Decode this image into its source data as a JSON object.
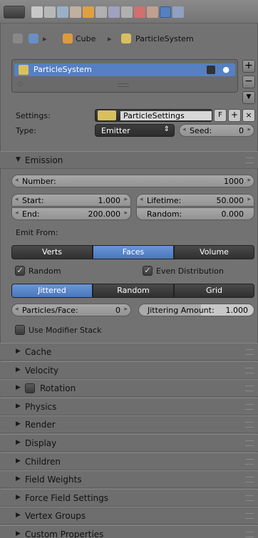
{
  "breadcrumb": {
    "object": "Cube",
    "system": "ParticleSystem"
  },
  "list": {
    "items": [
      {
        "label": "ParticleSystem"
      }
    ]
  },
  "settings": {
    "settings_label": "Settings:",
    "settings_value": "ParticleSettings",
    "fake_user": "F",
    "type_label": "Type:",
    "type_value": "Emitter",
    "seed_label": "Seed:",
    "seed_value": "0"
  },
  "emission": {
    "title": "Emission",
    "number_label": "Number:",
    "number_value": "1000",
    "start_label": "Start:",
    "start_value": "1.000",
    "end_label": "End:",
    "end_value": "200.000",
    "lifetime_label": "Lifetime:",
    "lifetime_value": "50.000",
    "random_label": "Random:",
    "random_value": "0.000",
    "emit_from_label": "Emit From:",
    "emit_from_options": [
      "Verts",
      "Faces",
      "Volume"
    ],
    "random_check": "Random",
    "even_dist_check": "Even Distribution",
    "dist_options": [
      "Jittered",
      "Random",
      "Grid"
    ],
    "particles_face_label": "Particles/Face:",
    "particles_face_value": "0",
    "jitter_label": "Jittering Amount:",
    "jitter_value": "1.000",
    "modifier_stack": "Use Modifier Stack"
  },
  "panels": [
    "Cache",
    "Velocity",
    "Rotation",
    "Physics",
    "Render",
    "Display",
    "Children",
    "Field Weights",
    "Force Field Settings",
    "Vertex Groups",
    "Custom Properties"
  ],
  "colors": {
    "accent": "#5680c2",
    "background": "#727272"
  }
}
